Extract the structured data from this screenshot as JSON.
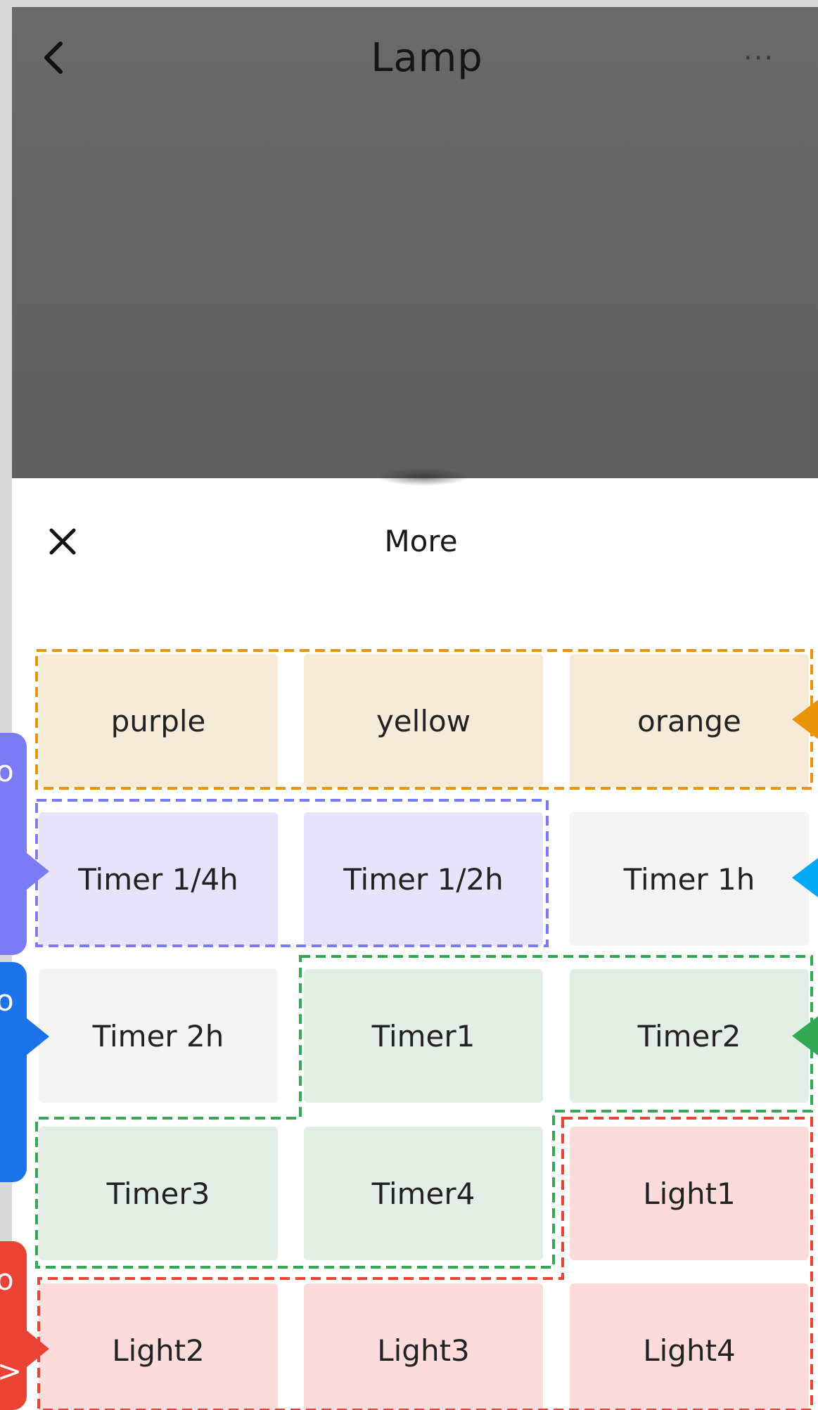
{
  "header": {
    "title": "Lamp",
    "menu_glyph": "···"
  },
  "sheet": {
    "title": "More"
  },
  "rows": [
    [
      "purple",
      "yellow",
      "orange"
    ],
    [
      "Timer 1/4h",
      "Timer 1/2h",
      "Timer 1h"
    ],
    [
      "Timer 2h",
      "Timer1",
      "Timer2"
    ],
    [
      "Timer3",
      "Timer4",
      "Light1"
    ],
    [
      "Light2",
      "Light3",
      "Light4"
    ]
  ],
  "left_tags": {
    "tag1": "o",
    "tag2": "o",
    "tag3": "o",
    "tag3_extra": ">"
  },
  "colors": {
    "orange_group": "#e8930a",
    "purple_group": "#7b7cf5",
    "green_group": "#34a853",
    "red_group": "#ea4335",
    "blue_tag": "#1a73e8",
    "cyan_arrow": "#03a9f4"
  },
  "icons": {
    "back": "chevron-left-icon",
    "more": "more-dots-icon",
    "close": "close-icon"
  }
}
